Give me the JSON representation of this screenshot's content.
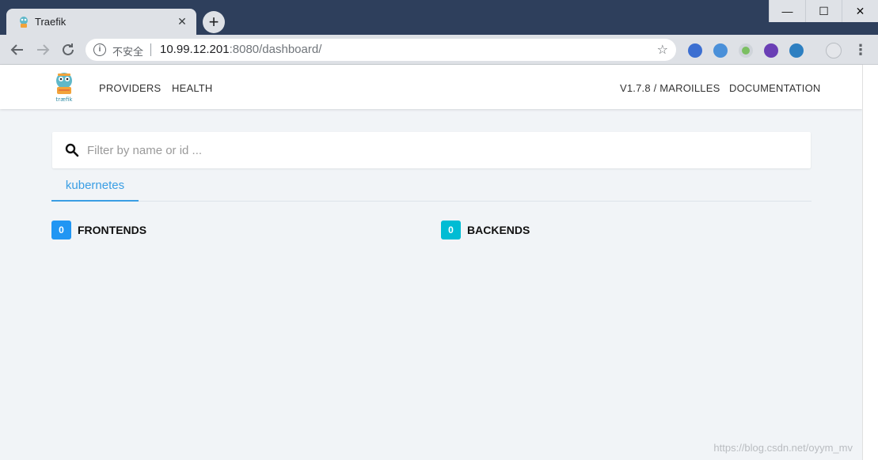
{
  "browser": {
    "tab_title": "Traefik",
    "tab_close": "✕",
    "new_tab": "+",
    "security_label": "不安全",
    "url_host": "10.99.12.201",
    "url_rest": ":8080/dashboard/",
    "window_controls": {
      "minimize": "—",
      "maximize": "☐",
      "close": "✕"
    }
  },
  "app": {
    "nav_left": [
      "PROVIDERS",
      "HEALTH"
    ],
    "nav_right": [
      "V1.7.8 / MAROILLES",
      "DOCUMENTATION"
    ]
  },
  "search": {
    "placeholder": "Filter by name or id ..."
  },
  "provider_tabs": [
    {
      "label": "kubernetes",
      "active": true
    }
  ],
  "stats": {
    "frontends": {
      "count": "0",
      "label": "FRONTENDS",
      "color": "#2196f3"
    },
    "backends": {
      "count": "0",
      "label": "BACKENDS",
      "color": "#00bcd4"
    }
  },
  "watermark": "https://blog.csdn.net/oyym_mv",
  "colors": {
    "accent": "#3a9ee4",
    "page_bg": "#f1f4f7",
    "chrome_dark": "#2e3f5c"
  },
  "icons": [
    "traefik-favicon",
    "info-icon",
    "star-icon",
    "search-icon",
    "traefik-logo",
    "menu-icon"
  ]
}
